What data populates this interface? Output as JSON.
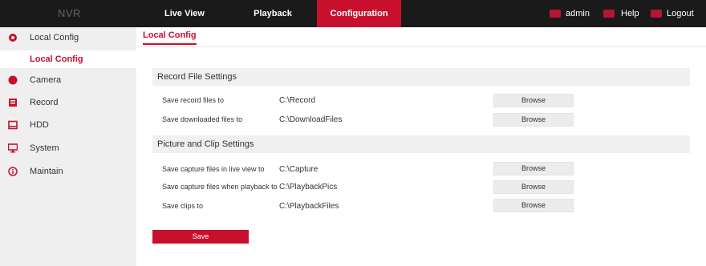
{
  "app": {
    "logo": "NVR"
  },
  "nav": {
    "tabs": [
      {
        "label": "Live View"
      },
      {
        "label": "Playback"
      },
      {
        "label": "Configuration"
      }
    ],
    "user": "admin",
    "help": "Help",
    "logout": "Logout"
  },
  "sidebar": {
    "items": [
      {
        "label": "Local Config",
        "icon": "gear-icon"
      },
      {
        "label": "Local Config"
      },
      {
        "label": "Camera",
        "icon": "camera-icon"
      },
      {
        "label": "Record",
        "icon": "record-icon"
      },
      {
        "label": "HDD",
        "icon": "hdd-icon"
      },
      {
        "label": "System",
        "icon": "monitor-icon"
      },
      {
        "label": "Maintain",
        "icon": "info-icon"
      }
    ]
  },
  "main": {
    "tab": "Local Config",
    "record_section": {
      "title": "Record File Settings",
      "rows": [
        {
          "label": "Save record files to",
          "value": "C:\\Record",
          "button": "Browse"
        },
        {
          "label": "Save downloaded files to",
          "value": "C:\\DownloadFiles",
          "button": "Browse"
        }
      ]
    },
    "picture_section": {
      "title": "Picture and Clip Settings",
      "rows": [
        {
          "label": "Save capture files in live view to",
          "value": "C:\\Capture",
          "button": "Browse"
        },
        {
          "label": "Save capture files when playback to",
          "value": "C:\\PlaybackPics",
          "button": "Browse"
        },
        {
          "label": "Save clips to",
          "value": "C:\\PlaybackFiles",
          "button": "Browse"
        }
      ]
    },
    "save_label": "Save"
  },
  "colors": {
    "accent": "#c8102e",
    "topbar": "#1a1a1a",
    "sidebar": "#efefef"
  }
}
